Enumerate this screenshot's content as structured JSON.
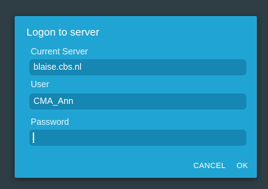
{
  "dialog": {
    "title": "Logon to server",
    "server_label": "Current Server",
    "server_value": "blaise.cbs.nl",
    "user_label": "User",
    "user_value": "CMA_Ann",
    "password_label": "Password",
    "password_value": "",
    "cancel_label": "CANCEL",
    "ok_label": "OK"
  },
  "colors": {
    "backdrop": "#2f3d44",
    "dialog_bg": "#20a4d3",
    "field_bg": "#1686b2",
    "text": "#ffffff"
  }
}
